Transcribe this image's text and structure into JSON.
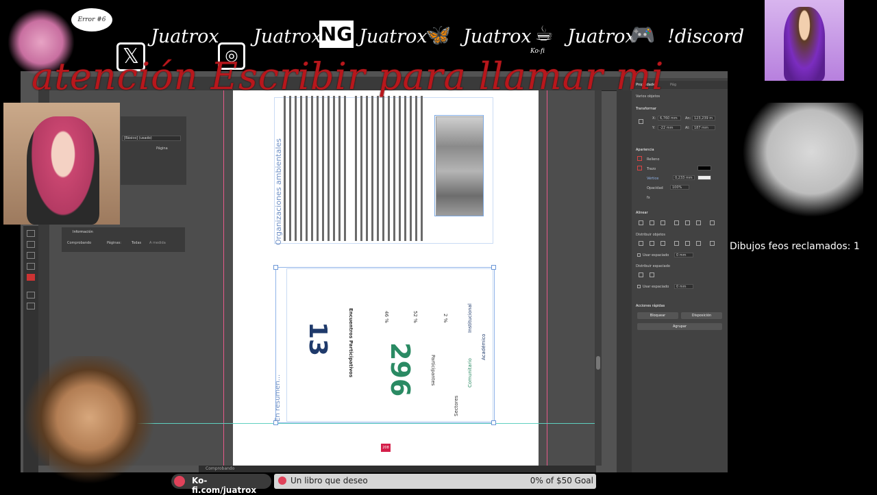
{
  "overlay": {
    "error_label": "Error #6",
    "socials": [
      {
        "icon": "x-twitter-icon",
        "glyph": "𝕏",
        "handle": "Juatrox"
      },
      {
        "icon": "instagram-icon",
        "glyph": "◎",
        "handle": "Juatrox"
      },
      {
        "icon": "newgrounds-icon",
        "glyph": "NG",
        "handle": "Juatrox"
      },
      {
        "icon": "bluesky-butterfly-icon",
        "glyph": "🦋",
        "handle": "Juatrox"
      },
      {
        "icon": "kofi-cup-icon",
        "glyph": "☕",
        "handle": "Juatrox",
        "sub": "Ko-fi"
      },
      {
        "icon": "gamepad-icon",
        "glyph": "🎮",
        "handle": "!discord"
      }
    ],
    "headline": "atención Escribir para llamar mi",
    "counter": "Dibujos feos reclamados: 1",
    "kofi_url": "Ko-fi.com/juatrox",
    "goal_item": "Un libro que deseo",
    "goal_status": "0% of $50 Goal"
  },
  "document": {
    "section_title_1": "Organizaciones ambientales",
    "section_title_2": "En resumen...",
    "stat_sessions": "13",
    "stat_sessions_label": "Encuentros Participativos",
    "stat_participants": "296",
    "stat_participants_label": "Participantes",
    "percents": [
      "46 %",
      "52 %",
      "2 %"
    ],
    "sectors_label": "Sectores",
    "sector_names": [
      "Institucional",
      "Académico",
      "Comunitario"
    ],
    "page_number": "208"
  },
  "float_panel": {
    "style_value": "[Básico] (usado)",
    "page_label": "Página"
  },
  "info_panel": {
    "title": "Información",
    "checking": "Comprobando",
    "pages_label": "Páginas:",
    "all_label": "Todas",
    "range_label": "A medida"
  },
  "status": {
    "state": "Comprobando"
  },
  "properties": {
    "tabs": [
      "Propiedades",
      "Pág"
    ],
    "selection": "Varios objetos",
    "transform_title": "Transformar",
    "x_label": "X:",
    "x_value": "6,760 mm",
    "y_label": "Y:",
    "y_value": "-22 mm",
    "w_label": "An:",
    "w_value": "123,239 m",
    "h_label": "Al:",
    "h_value": "187 mm",
    "appearance_title": "Apariencia",
    "fill_label": "Relleno",
    "stroke_label": "Trazo",
    "stroke_weight_label": "Vértice",
    "stroke_weight_value": "0,233 mm",
    "opacity_label": "Opacidad",
    "opacity_value": "100%",
    "fx_label": "fx",
    "align_title": "Alinear",
    "distribute_title": "Distribuir objetos",
    "use_spacing": "Usar espaciado",
    "spacing_value": "0 mm",
    "distribute_spacing_title": "Distribuir espaciado",
    "quick_actions_title": "Acciones rápidas",
    "lock_button": "Bloquear",
    "arrange_button": "Disposición",
    "group_button": "Agrupar"
  },
  "colors": {
    "accent_red": "#b8171c",
    "stat_blue": "#1f3a6b",
    "stat_green": "#2a8a63",
    "guide_pink": "#e85a8a",
    "guide_cyan": "#5fd0c0"
  }
}
